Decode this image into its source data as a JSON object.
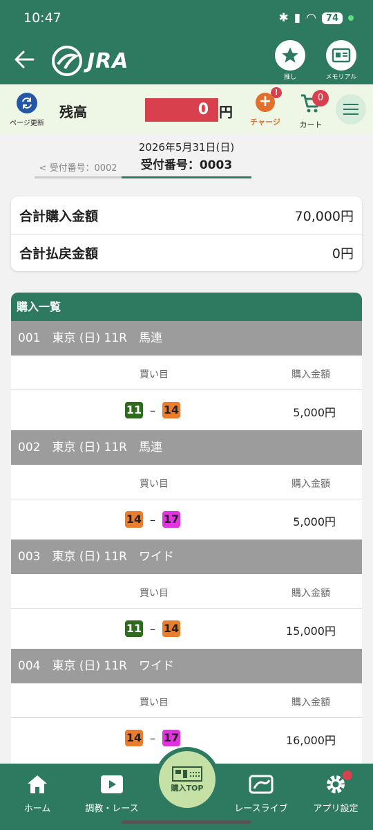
{
  "status": {
    "time": "10:47",
    "battery": "74"
  },
  "header": {
    "logo": "JRA",
    "fav_label": "推し",
    "memorial_label": "メモリアル"
  },
  "balance": {
    "refresh_label": "ページ更新",
    "label": "残高",
    "value": "0",
    "unit": "円",
    "charge_label": "チャージ",
    "charge_badge": "!",
    "cart_label": "カート",
    "cart_count": "0"
  },
  "receipt": {
    "date": "2026年5月31日(日)",
    "prev": "< 受付番号：0002",
    "current": "受付番号：0003"
  },
  "totals": {
    "purchase_label": "合計購入金額",
    "purchase_value": "70,000円",
    "refund_label": "合計払戻金額",
    "refund_value": "0円"
  },
  "list": {
    "title": "購入一覧",
    "col_bet": "買い目",
    "col_amount": "購入金額",
    "bets": [
      {
        "head": "001　東京 (日) 11R　馬連",
        "n1": "11",
        "n2": "14",
        "amount": "5,000円"
      },
      {
        "head": "002　東京 (日) 11R　馬連",
        "n1": "14",
        "n2": "17",
        "amount": "5,000円"
      },
      {
        "head": "003　東京 (日) 11R　ワイド",
        "n1": "11",
        "n2": "14",
        "amount": "15,000円"
      },
      {
        "head": "004　東京 (日) 11R　ワイド",
        "n1": "14",
        "n2": "17",
        "amount": "16,000円"
      }
    ]
  },
  "nav": {
    "home": "ホーム",
    "training": "調教・レース",
    "purchase_top": "購入TOP",
    "live": "レースライブ",
    "settings": "アプリ設定"
  },
  "colors": {
    "brand": "#2e7a60",
    "balance_red": "#d9404e",
    "charge_orange": "#e0702c"
  }
}
